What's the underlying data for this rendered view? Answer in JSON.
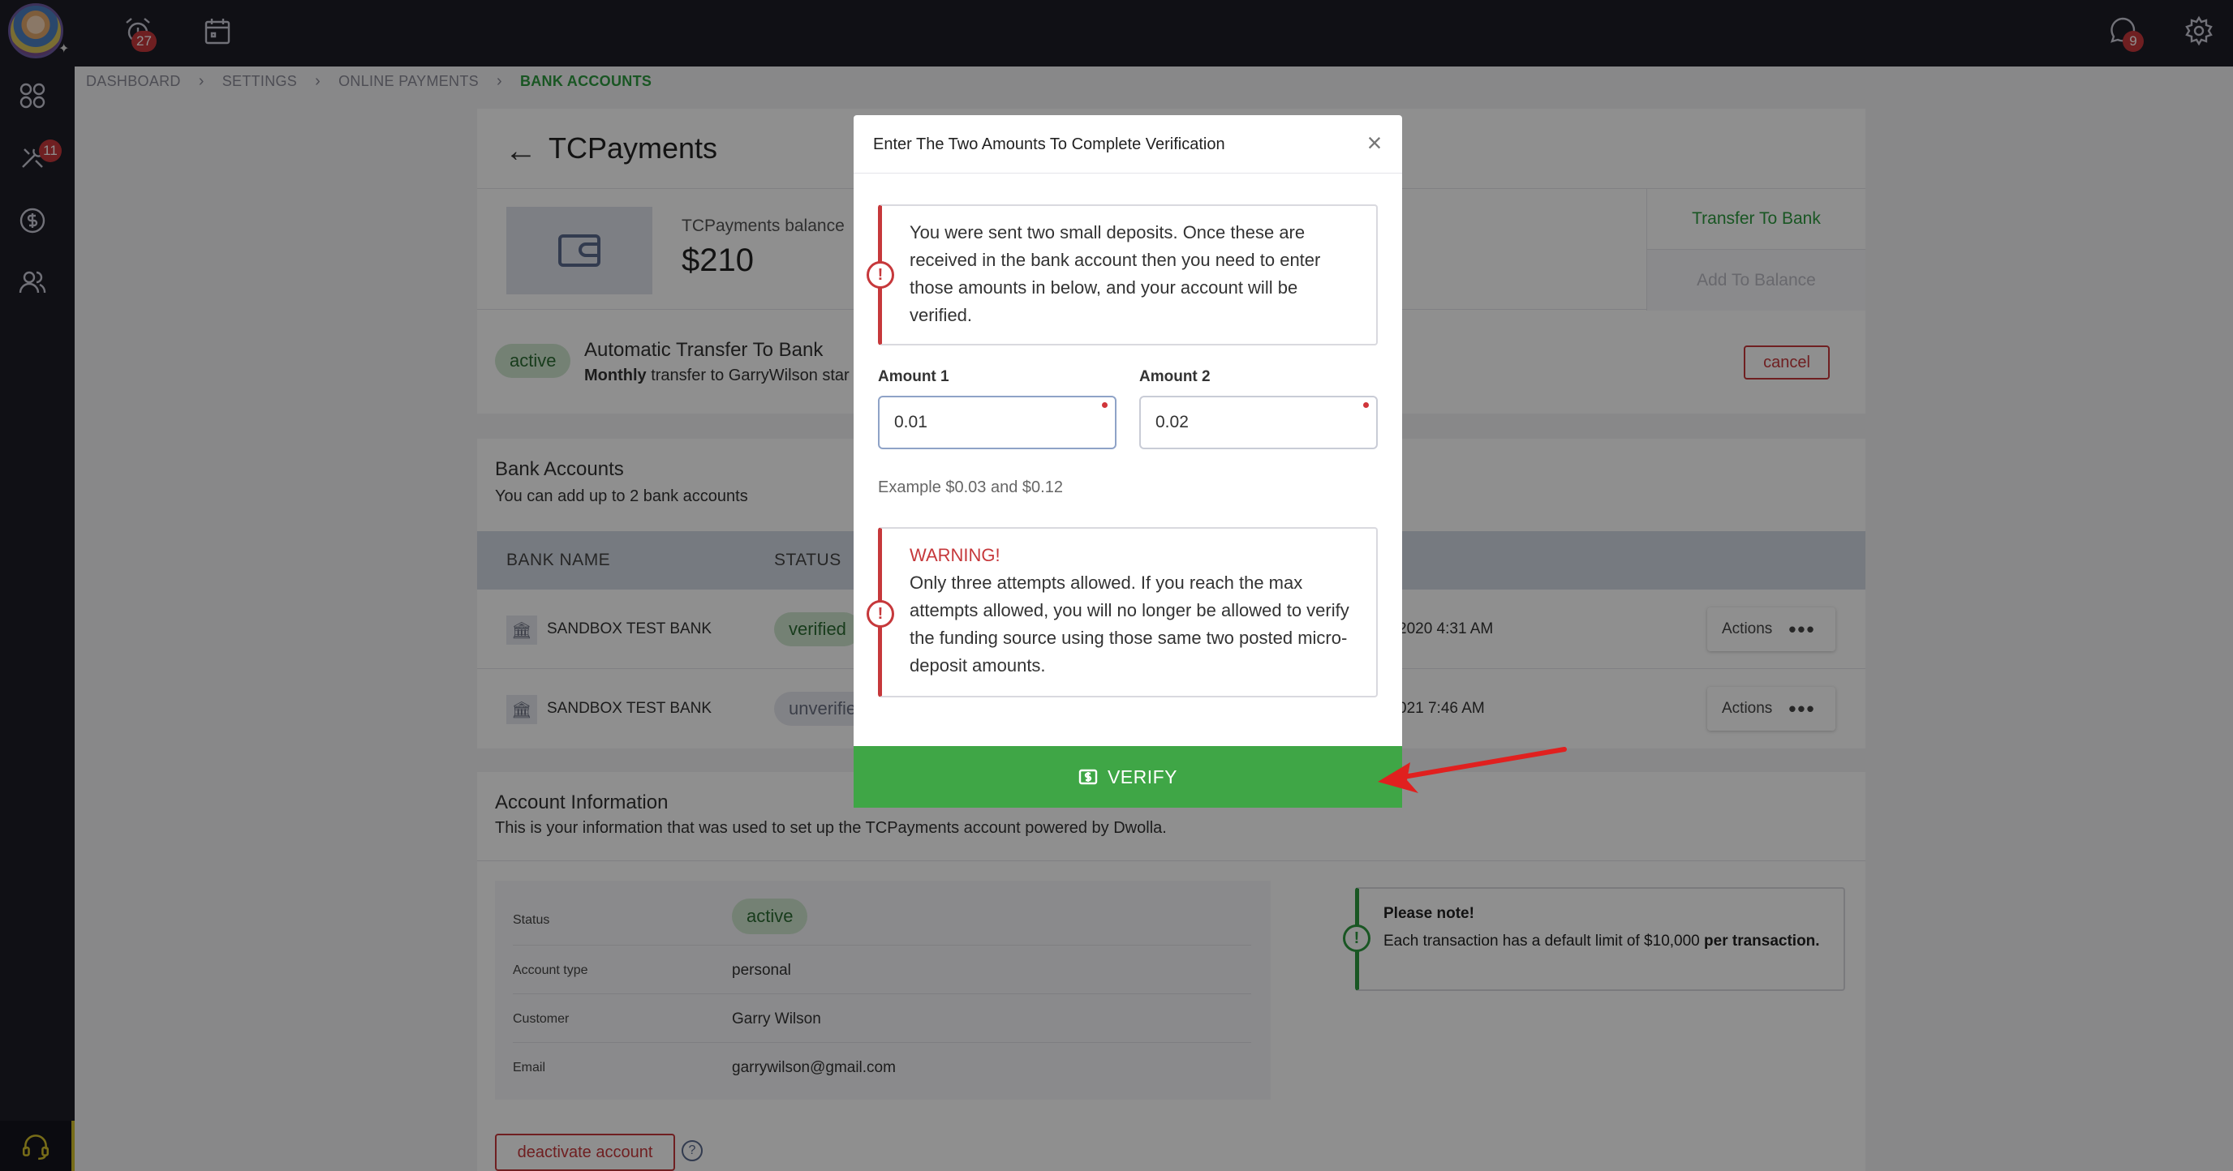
{
  "sidebar": {
    "badge": "11"
  },
  "topbar": {
    "alarm_badge": "27",
    "notif_badge": "9"
  },
  "breadcrumb": {
    "items": [
      "DASHBOARD",
      "SETTINGS",
      "ONLINE PAYMENTS"
    ],
    "current": "BANK ACCOUNTS"
  },
  "page": {
    "title": "TCPayments",
    "balance_label": "TCPayments balance",
    "balance_value": "$210",
    "transfer_label": "Transfer To Bank",
    "add_balance_label": "Add To Balance",
    "auto_status": "active",
    "auto_title": "Automatic Transfer To Bank",
    "auto_freq": "Monthly",
    "auto_text": " transfer to GarryWilson star",
    "cancel_label": "cancel"
  },
  "banks": {
    "title": "Bank Accounts",
    "subtitle": "You can add up to 2 bank accounts",
    "columns": [
      "BANK NAME",
      "STATUS"
    ],
    "rows": [
      {
        "name": "SANDBOX TEST BANK",
        "status": "verified",
        "date": "2020 4:31 AM",
        "actions": "Actions"
      },
      {
        "name": "SANDBOX TEST BANK",
        "status": "unverifie",
        "date": "021 7:46 AM",
        "actions": "Actions"
      }
    ]
  },
  "account": {
    "title": "Account Information",
    "subtitle": "This is your information that was used to set up the TCPayments account powered by Dwolla.",
    "rows": [
      {
        "label": "Status",
        "value": "active"
      },
      {
        "label": "Account type",
        "value": "personal"
      },
      {
        "label": "Customer",
        "value": "Garry Wilson"
      },
      {
        "label": "Email",
        "value": "garrywilson@gmail.com"
      }
    ],
    "note_title": "Please note!",
    "note_text": "Each transaction has a default limit of $10,000 ",
    "note_bold": "per transaction.",
    "deactivate_label": "deactivate account",
    "help": "?"
  },
  "modal": {
    "title": "Enter The Two Amounts To Complete Verification",
    "close": "×",
    "info": "You were sent two small deposits. Once these are received in the bank account then you need to enter those amounts in below, and your account will be verified.",
    "amount1_label": "Amount 1",
    "amount1_value": "0.01",
    "amount2_label": "Amount 2",
    "amount2_value": "0.02",
    "example": "Example $0.03 and $0.12",
    "warning_title": "WARNING!",
    "warning_text": "Only three attempts allowed. If you reach the max attempts allowed, you will no longer be allowed to verify the funding source using those same two posted micro-deposit amounts.",
    "verify_label": "VERIFY"
  },
  "colors": {
    "accent": "#3fa646",
    "danger": "#c6383b",
    "sidebar": "#1d1d27"
  }
}
